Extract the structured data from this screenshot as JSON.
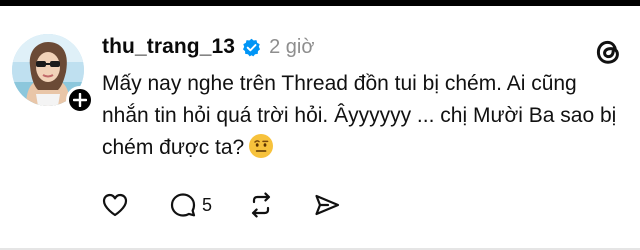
{
  "post": {
    "username": "thu_trang_13",
    "time_ago": "2 giờ",
    "text": "Mấy nay nghe trên Thread đồn tui bị chém. Ai cũng nhắn tin hỏi quá trời hỏi. Âyyyyyy ... chị Mười Ba sao bị chém được ta?",
    "emoji": "face-with-raised-eyebrow",
    "reply_count": "5"
  },
  "icons": {
    "verified": "verified-badge-icon",
    "follow": "plus-icon",
    "logo": "threads-logo-icon",
    "like": "heart-icon",
    "reply": "comment-icon",
    "repost": "repost-icon",
    "share": "share-icon"
  },
  "colors": {
    "verified_blue": "#0095f6",
    "muted_text": "#8e8e8e",
    "emoji_yellow": "#f7c23c"
  }
}
